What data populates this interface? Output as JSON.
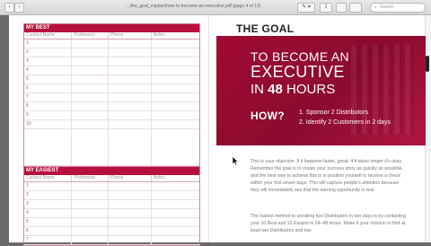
{
  "browser": {
    "url": "…/the_goal_explain/how-to-become-an-executive.pdf (page 4 of 12)",
    "search_placeholder": "Search",
    "back_label": "‹",
    "forward_label": "›",
    "edit_label": "✎ ▾",
    "share_label": "⇪"
  },
  "tables": {
    "best": {
      "title": "MY BEST",
      "columns": [
        "Contact Name",
        "Profession",
        "Phone",
        "Notes"
      ],
      "rows": [
        "1",
        "2",
        "3",
        "4",
        "5",
        "6",
        "7",
        "8",
        "9",
        "10"
      ]
    },
    "easiest": {
      "title": "MY EASIEST",
      "columns": [
        "Contact Name",
        "Profession",
        "Phone",
        "Notes"
      ],
      "rows": [
        "1",
        "2",
        "3",
        "4",
        "5",
        "6",
        "7"
      ]
    }
  },
  "goal": {
    "title": "THE GOAL",
    "line1": "TO BECOME AN",
    "line2": "EXECUTIVE",
    "line3_pre": "IN",
    "line3_num": "48",
    "line3_post": "HOURS",
    "how_label": "HOW?",
    "how_items": [
      "1.  Sponsor 2 Distributors",
      "2.  Identify 2 Customers in 2 days"
    ]
  },
  "body": {
    "para1": "This is your objective. If it happens faster, great. If it takes longer it's okay. Remember the goal is to create your success story as quickly as possible, and the best way to achieve this is to position yourself to receive a check within your first seven days. This will capture people's attention because they will immediately see that the earning opportunity is real.",
    "para2": "The fastest method to enrolling two Distributors in two days is by contacting your 10 Best and 10 Easiest in 24–48 hours. Make it your mission to find at least two Distributors and two"
  }
}
